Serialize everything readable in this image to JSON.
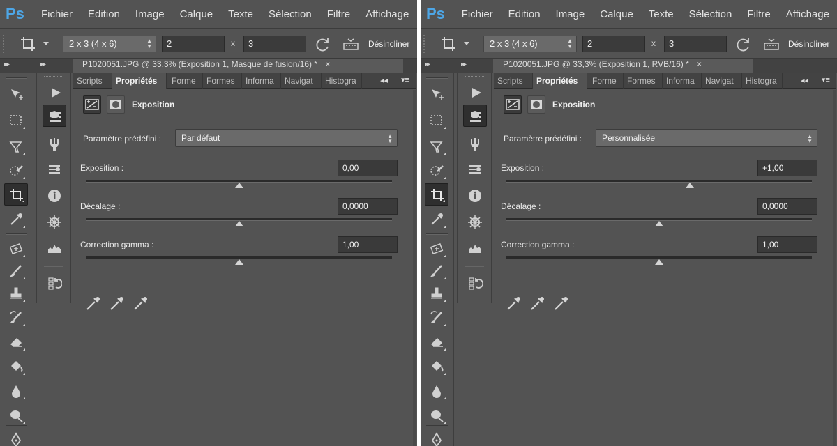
{
  "app": {
    "logo": "Ps"
  },
  "menu": [
    "Fichier",
    "Edition",
    "Image",
    "Calque",
    "Texte",
    "Sélection",
    "Filtre",
    "Affichage"
  ],
  "options_bar": {
    "ratio": "2 x 3 (4 x 6)",
    "width_value": "2",
    "times": "x",
    "height_value": "3",
    "straighten_label": "Désincliner"
  },
  "tools": [
    "move-tool",
    "marquee-tool",
    "lasso-tool",
    "quick-select-tool",
    "crop-tool",
    "eyedropper-tool",
    "spot-healing-tool",
    "brush-tool",
    "clone-stamp-tool",
    "history-brush-tool",
    "eraser-tool",
    "paint-bucket-tool",
    "blur-tool",
    "dodge-tool",
    "pen-tool"
  ],
  "panels": [
    {
      "doc_tab": "P1020051.JPG @ 33,3% (Exposition 1, Masque de fusion/16) *",
      "tabs": [
        "Scripts",
        "Propriétés",
        "Forme",
        "Formes",
        "Informa",
        "Navigat",
        "Histogra"
      ],
      "active_tab": "Propriétés",
      "adjustment_title": "Exposition",
      "preset_label": "Paramètre prédéfini :",
      "preset_value": "Par défaut",
      "sliders": [
        {
          "label": "Exposition :",
          "value": "0,00",
          "position": 0.5
        },
        {
          "label": "Décalage :",
          "value": "0,0000",
          "position": 0.5
        },
        {
          "label": "Correction gamma :",
          "value": "1,00",
          "position": 0.5
        }
      ]
    },
    {
      "doc_tab": "P1020051.JPG @ 33,3% (Exposition 1, RVB/16) *",
      "tabs": [
        "Scripts",
        "Propriétés",
        "Forme",
        "Formes",
        "Informa",
        "Navigat",
        "Histogra"
      ],
      "active_tab": "Propriétés",
      "adjustment_title": "Exposition",
      "preset_label": "Paramètre prédéfini :",
      "preset_value": "Personnalisée",
      "sliders": [
        {
          "label": "Exposition :",
          "value": "+1,00",
          "position": 0.6
        },
        {
          "label": "Décalage :",
          "value": "0,0000",
          "position": 0.5
        },
        {
          "label": "Correction gamma :",
          "value": "1,00",
          "position": 0.5
        }
      ]
    }
  ],
  "colors": {
    "background": "#535353",
    "dark": "#3a3a3a",
    "accent": "#4da6e6"
  }
}
